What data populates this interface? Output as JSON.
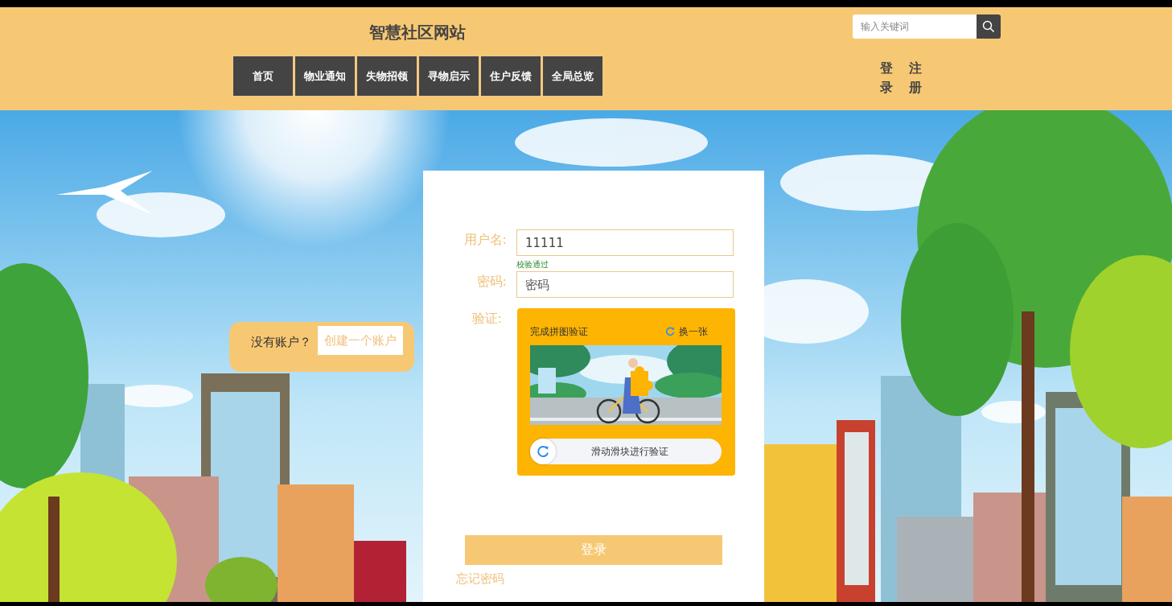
{
  "header": {
    "title": "智慧社区网站",
    "nav": [
      {
        "label": "首页"
      },
      {
        "label": "物业通知"
      },
      {
        "label": "失物招领"
      },
      {
        "label": "寻物启示"
      },
      {
        "label": "住户反馈"
      },
      {
        "label": "全局总览"
      }
    ],
    "search": {
      "placeholder": "输入关键词"
    },
    "account_links": [
      "登录",
      "注册"
    ]
  },
  "signup_prompt": {
    "text": "没有账户？",
    "link": "创建一个账户"
  },
  "login_form": {
    "fields": [
      {
        "label": "用户名:",
        "value": "11111",
        "hint": "校验通过"
      },
      {
        "label": "密码:",
        "placeholder": "密码"
      }
    ],
    "captcha": {
      "label": "验证:",
      "title": "完成拼图验证",
      "refresh": "换一张",
      "slider_text": "滑动滑块进行验证",
      "level": 0
    },
    "submit": "登录",
    "forgot": "忘记密码"
  }
}
